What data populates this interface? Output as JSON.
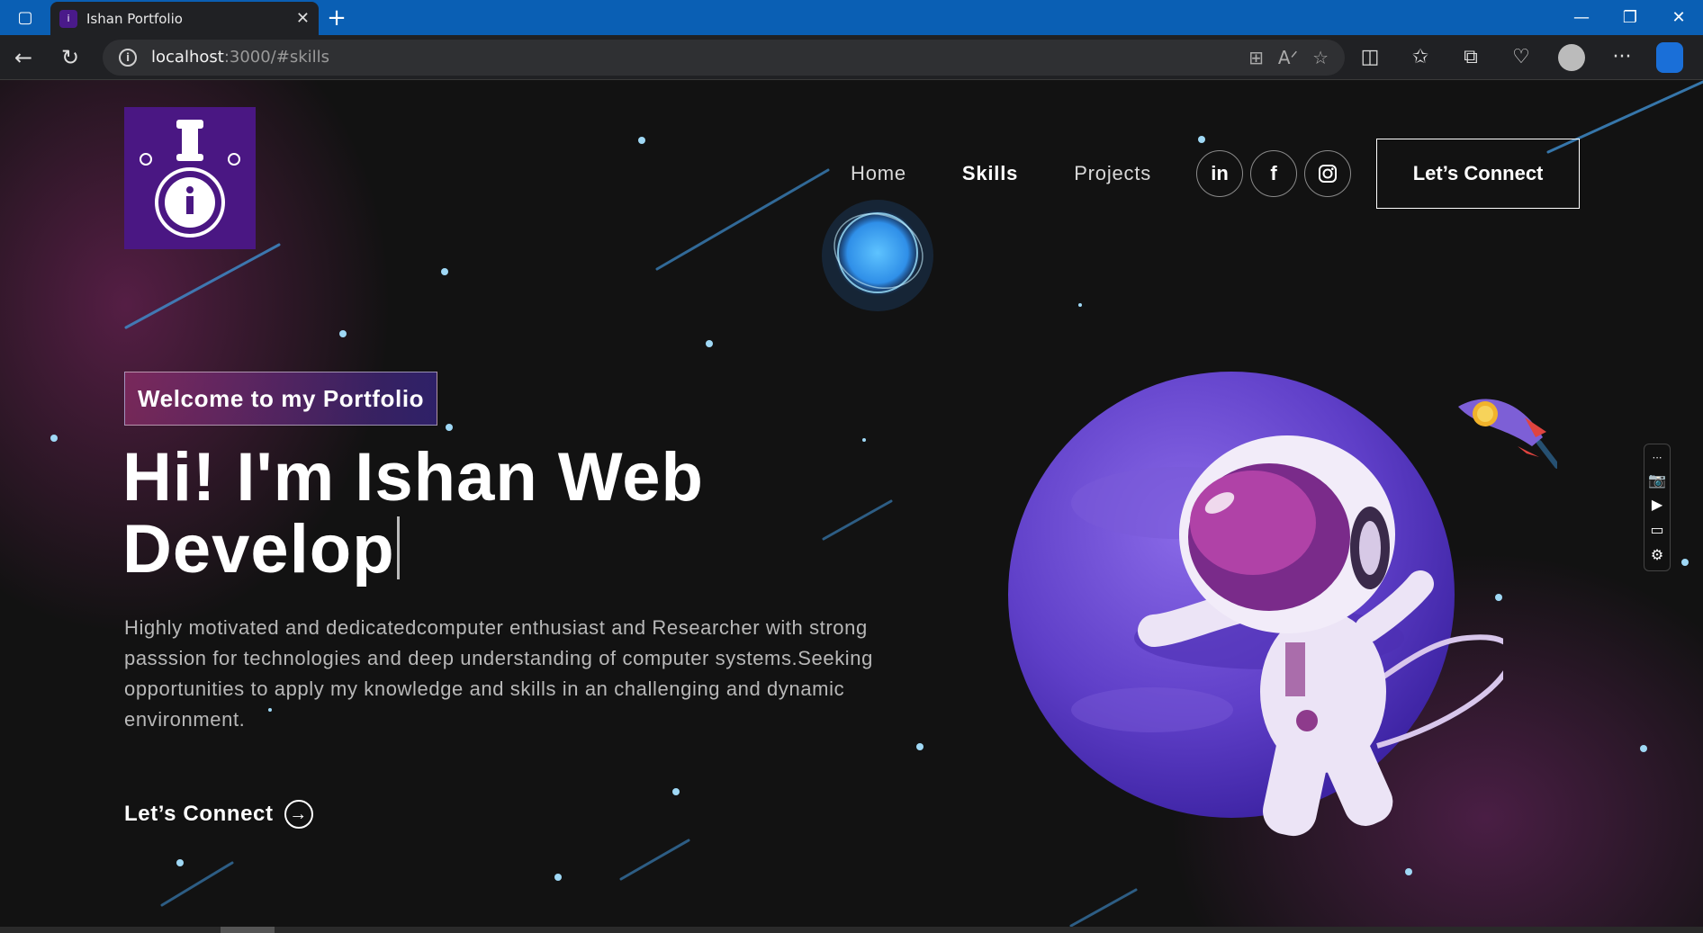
{
  "browser": {
    "tab_title": "Ishan Portfolio",
    "url_host": "localhost",
    "url_path": ":3000/#skills"
  },
  "nav": {
    "links": [
      "Home",
      "Skills",
      "Projects"
    ],
    "active": "Skills",
    "connect_label": "Let’s Connect"
  },
  "social": [
    {
      "icon": "linkedin-icon",
      "glyph": "in"
    },
    {
      "icon": "facebook-icon",
      "glyph": "f"
    },
    {
      "icon": "instagram-icon",
      "glyph": "◎"
    }
  ],
  "hero": {
    "tagline": "Welcome to my Portfolio",
    "headline": "Hi! I'm Ishan Web Develop",
    "description": "Highly motivated and dedicatedcomputer enthusiast and Researcher with strong passsion for technologies and deep understanding of computer systems.Seeking opportunities to apply my knowledge and skills in an challenging and dynamic environment.",
    "cta_label": "Let’s Connect"
  },
  "colors": {
    "logo_bg": "#4a1783",
    "planet": "#6a48d0",
    "accent_blue": "#4ea8e0"
  }
}
